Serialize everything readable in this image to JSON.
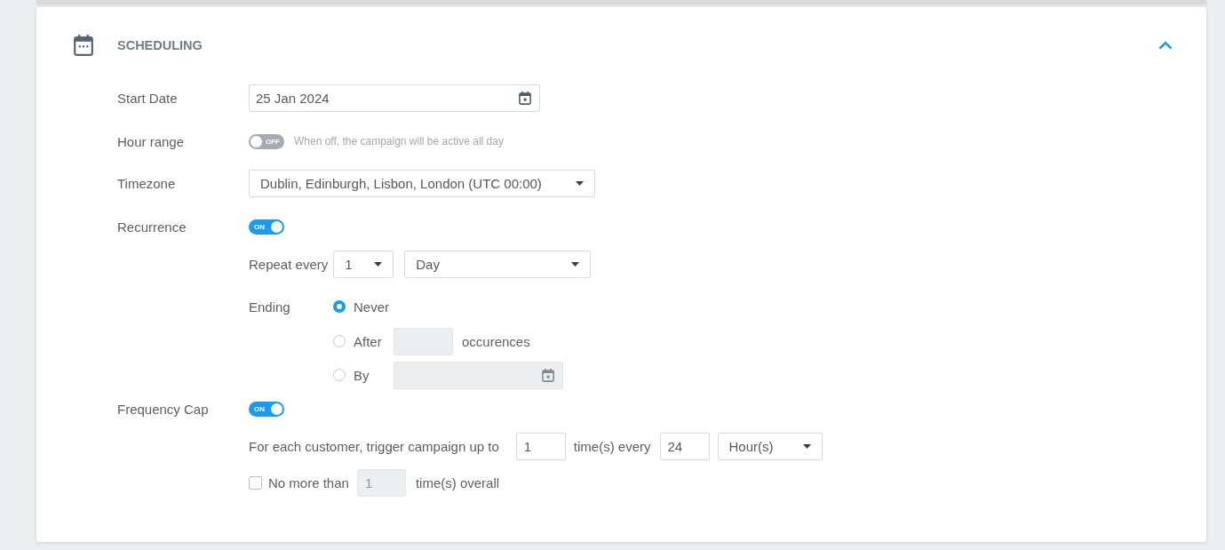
{
  "section": {
    "title": "SCHEDULING",
    "expanded": true
  },
  "start_date": {
    "label": "Start Date",
    "value": "25 Jan 2024"
  },
  "hour_range": {
    "label": "Hour range",
    "toggle": {
      "on": false,
      "text": "OFF"
    },
    "hint": "When off, the campaign will be active all day"
  },
  "timezone": {
    "label": "Timezone",
    "value": "Dublin, Edinburgh, Lisbon, London (UTC 00:00)"
  },
  "recurrence": {
    "label": "Recurrence",
    "toggle": {
      "on": true,
      "text": "ON"
    },
    "repeat_label": "Repeat every",
    "interval": "1",
    "unit": "Day",
    "ending_label": "Ending",
    "ending_options": [
      {
        "kind": "none",
        "label": "Never",
        "selected": true
      },
      {
        "kind": "count",
        "label": "After",
        "selected": false,
        "field_disabled": true,
        "suffix": "occurences"
      },
      {
        "kind": "date",
        "label": "By",
        "selected": false,
        "field_disabled": true
      }
    ]
  },
  "frequency_cap": {
    "label": "Frequency Cap",
    "toggle": {
      "on": true,
      "text": "ON"
    },
    "trigger_text": "For each customer, trigger campaign up to",
    "times": "1",
    "every_text": "time(s) every",
    "period": "24",
    "period_unit": "Hour(s)",
    "limit": {
      "checked": false,
      "label": "No more than",
      "value": "1",
      "disabled": true,
      "suffix": "time(s) overall"
    }
  }
}
